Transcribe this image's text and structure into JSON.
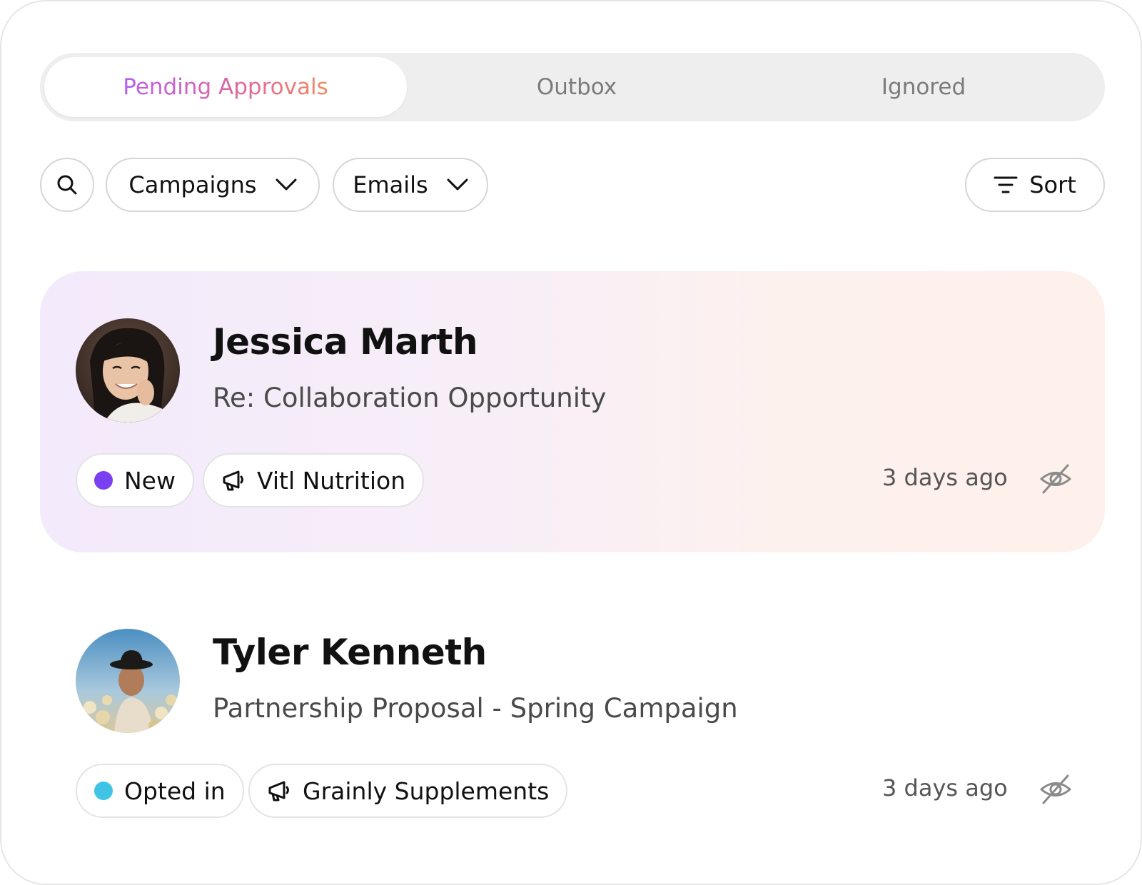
{
  "tabs": [
    {
      "label": "Pending Approvals",
      "active": true
    },
    {
      "label": "Outbox",
      "active": false
    },
    {
      "label": "Ignored",
      "active": false
    }
  ],
  "toolbar": {
    "search_icon": "search-icon",
    "campaigns_label": "Campaigns",
    "emails_label": "Emails",
    "sort_label": "Sort"
  },
  "messages": [
    {
      "name": "Jessica Marth",
      "subject": "Re: Collaboration Opportunity",
      "status": "New",
      "status_color": "#7b3ff2",
      "campaign": "Vitl Nutrition",
      "time": "3 days ago",
      "highlighted": true
    },
    {
      "name": "Tyler Kenneth",
      "subject": "Partnership Proposal - Spring Campaign",
      "status": "Opted in",
      "status_color": "#3fc4e6",
      "campaign": "Grainly Supplements",
      "time": "3 days ago",
      "highlighted": false
    }
  ],
  "colors": {
    "accent_gradient_start": "#b65ef0",
    "accent_gradient_end": "#f08a5c"
  }
}
